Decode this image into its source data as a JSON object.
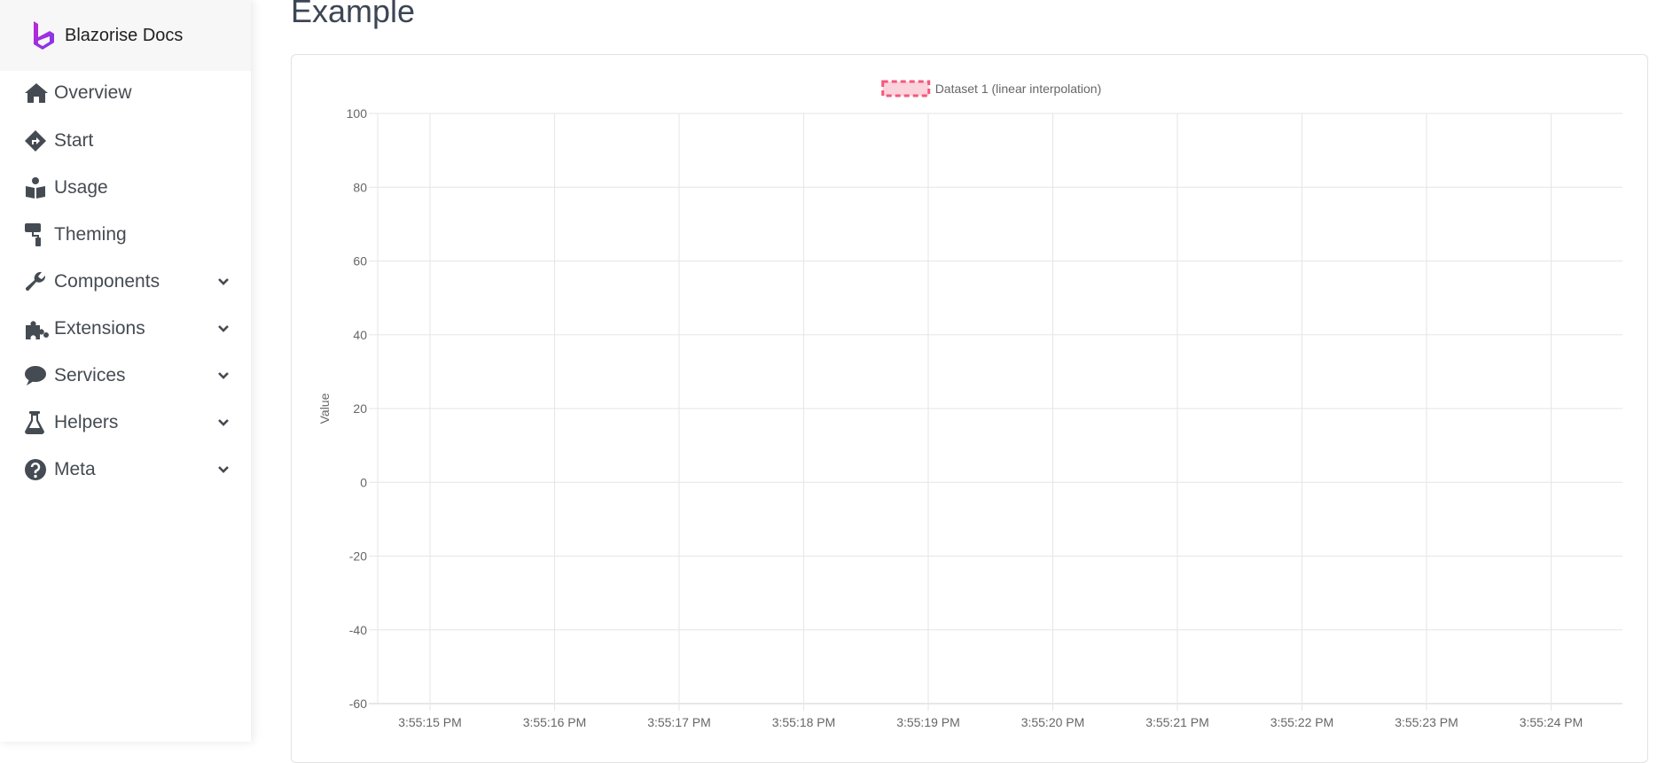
{
  "brand": {
    "title": "Blazorise Docs",
    "logo_color": "#8a2be2"
  },
  "sidebar": {
    "items": [
      {
        "label": "Overview",
        "icon": "home-icon",
        "expandable": false
      },
      {
        "label": "Start",
        "icon": "directions-icon",
        "expandable": false
      },
      {
        "label": "Usage",
        "icon": "book-reader-icon",
        "expandable": false
      },
      {
        "label": "Theming",
        "icon": "paint-roller-icon",
        "expandable": false
      },
      {
        "label": "Components",
        "icon": "wrench-icon",
        "expandable": true
      },
      {
        "label": "Extensions",
        "icon": "puzzle-piece-icon",
        "expandable": true
      },
      {
        "label": "Services",
        "icon": "comment-icon",
        "expandable": true
      },
      {
        "label": "Helpers",
        "icon": "flask-icon",
        "expandable": true
      },
      {
        "label": "Meta",
        "icon": "question-circle-icon",
        "expandable": true
      }
    ]
  },
  "main": {
    "title": "Example"
  },
  "chart_data": {
    "type": "line",
    "title": "",
    "xlabel": "",
    "ylabel": "Value",
    "ylim": [
      -60,
      100
    ],
    "yticks": [
      100,
      80,
      60,
      40,
      20,
      0,
      -20,
      -40,
      -60
    ],
    "x": [
      "3:55:15 PM",
      "3:55:16 PM",
      "3:55:17 PM",
      "3:55:18 PM",
      "3:55:19 PM",
      "3:55:20 PM",
      "3:55:21 PM",
      "3:55:22 PM",
      "3:55:23 PM",
      "3:55:24 PM"
    ],
    "grid": true,
    "legend": "top-center",
    "series": [
      {
        "name": "Dataset 1 (linear interpolation)",
        "values": [],
        "border_color": "#f4587c",
        "fill_color": "#fbd3dc",
        "dashed": true
      }
    ]
  }
}
